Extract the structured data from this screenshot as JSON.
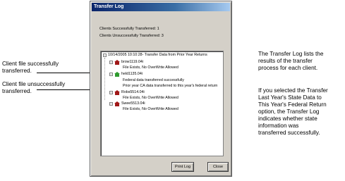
{
  "window": {
    "title": "Transfer Log"
  },
  "summary": {
    "successful": "Clients Successfully Transferred:   1",
    "unsuccessful": "Clients Unsuccessfully Transferred:  3"
  },
  "log": {
    "header": "10/14/2005 10:10:28- Transfer Data from Prior Year Returns",
    "entries": [
      {
        "client": "brow1119.04i",
        "status": "fail",
        "messages": [
          "File Exists, No OverWrite Allowed"
        ]
      },
      {
        "client": "held1135.04i",
        "status": "success",
        "messages": [
          "Federal data transferred successfully",
          "Prior year CA data transferred to this year's federal return"
        ]
      },
      {
        "client": "Robs5514.04i",
        "status": "fail",
        "messages": [
          "File Exists, No OverWrite Allowed"
        ]
      },
      {
        "client": "Swee5513.04i",
        "status": "fail",
        "messages": [
          "File Exists, No OverWrite Allowed"
        ]
      }
    ]
  },
  "buttons": {
    "print": "Print Log",
    "close": "Close"
  },
  "annotations": {
    "success_line1": "Client file successfully",
    "success_line2": "transferred.",
    "fail_line1": "Client file unsuccessfully",
    "fail_line2": "transferred.",
    "right1": [
      "The Transfer Log lists the",
      "results of the transfer",
      "process for each client."
    ],
    "right2": [
      "If you selected the Transfer",
      "Last Year's State Data to",
      "This Year's Federal Return",
      "option, the Transfer Log",
      "indicates whether state",
      "information was",
      "transferred successfully."
    ]
  },
  "colors": {
    "fail_icon": "#a01818",
    "success_icon": "#2e9a2e",
    "titlebar": "#0a246a"
  },
  "icons": {
    "fail": "house-red-icon",
    "success": "house-green-icon"
  }
}
